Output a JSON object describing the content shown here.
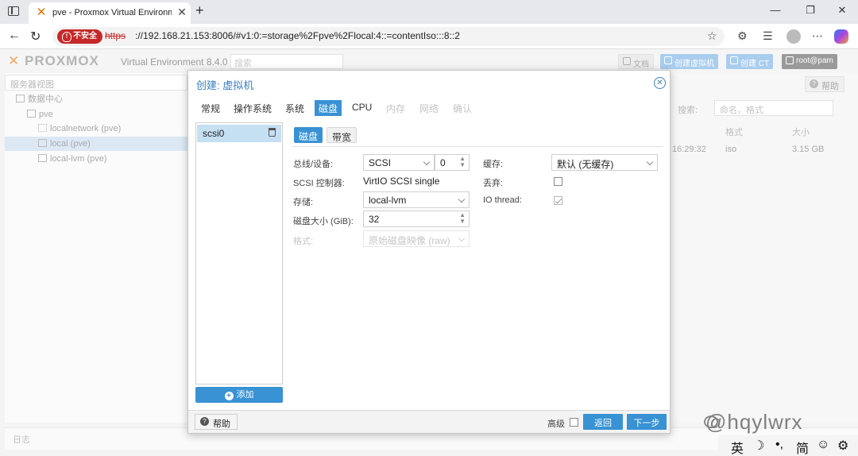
{
  "browser": {
    "tab_title": "pve - Proxmox Virtual Environment",
    "tab_favicon": "proxmox-x-icon",
    "insecure_label": "不安全",
    "url_scheme": "https",
    "url_rest": "://192.168.21.153:8006/#v1:0:=storage%2Fpve%2Flocal:4::=contentIso:::8::2"
  },
  "pve": {
    "logo": "PROXMOX",
    "product": "Virtual Environment 8.4.0",
    "search_placeholder": "搜索",
    "doc_btn": "文档",
    "create_vm_btn": "创建虚拟机",
    "create_ct_btn": "创建 CT",
    "user_btn": "root@pam",
    "tree_view": "服务器视图",
    "tree": {
      "datacenter": "数据中心",
      "node": "pve",
      "localnetwork": "localnetwork (pve)",
      "local": "local (pve)",
      "local_lvm": "local-lvm (pve)"
    },
    "right": {
      "help": "帮助",
      "search_label": "搜索:",
      "search_placeholder": "命名，格式",
      "col_format": "格式",
      "col_size": "大小",
      "row_time": "16:29:32",
      "row_format": "iso",
      "row_size": "3.15 GB"
    },
    "log": "日志"
  },
  "dialog": {
    "title": "创建: 虚拟机",
    "tabs": [
      {
        "label": "常规"
      },
      {
        "label": "操作系统"
      },
      {
        "label": "系统"
      },
      {
        "label": "磁盘"
      },
      {
        "label": "CPU"
      },
      {
        "label": "内存"
      },
      {
        "label": "网络"
      },
      {
        "label": "确认"
      }
    ],
    "active_tab": "磁盘",
    "disk_list": [
      "scsi0"
    ],
    "add_label": "添加",
    "subtabs": {
      "disk": "磁盘",
      "bandwidth": "带宽"
    },
    "fields": {
      "bus_label": "总线/设备:",
      "bus_value": "SCSI",
      "device_value": "0",
      "scsi_ctrl_label": "SCSI 控制器:",
      "scsi_ctrl_value": "VirtIO SCSI single",
      "storage_label": "存储:",
      "storage_value": "local-lvm",
      "disk_size_label": "磁盘大小 (GiB):",
      "disk_size_value": "32",
      "format_label": "格式:",
      "format_value": "原始磁盘映像 (raw)",
      "cache_label": "缓存:",
      "cache_value": "默认 (无缓存)",
      "discard_label": "丢弃:",
      "discard_checked": false,
      "io_thread_label": "IO thread:",
      "io_thread_checked": true
    },
    "footer": {
      "help": "帮助",
      "advanced": "高级",
      "advanced_checked": false,
      "back": "返回",
      "next": "下一步"
    }
  },
  "overlay": {
    "watermark": "@hqylwrx",
    "ime": [
      "英",
      "☽",
      "•,",
      "简",
      "☺",
      "⚙"
    ]
  },
  "colors": {
    "accent": "#3892d4",
    "title_blue": "#3a7fc4",
    "insecure_red": "#c62828",
    "proxmox_orange": "#e57000"
  }
}
